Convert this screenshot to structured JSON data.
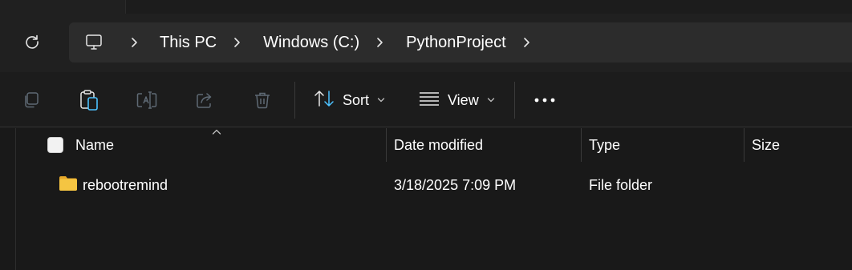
{
  "breadcrumb": [
    "This PC",
    "Windows (C:)",
    "PythonProject"
  ],
  "toolbar": {
    "sort_label": "Sort",
    "view_label": "View"
  },
  "columns": {
    "name": "Name",
    "date_modified": "Date modified",
    "type": "Type",
    "size": "Size"
  },
  "rows": [
    {
      "name": "rebootremind",
      "date_modified": "3/18/2025 7:09 PM",
      "type": "File folder",
      "size": ""
    }
  ],
  "icons": {
    "refresh": "refresh-icon",
    "this_pc": "monitor-icon",
    "copy": "copy-icon",
    "paste": "paste-icon",
    "rename": "rename-icon",
    "share": "share-icon",
    "delete": "trash-icon",
    "sort": "sort-icon",
    "view": "view-icon",
    "more": "more-icon",
    "folder": "folder-icon"
  },
  "colors": {
    "folder": "#f5c542",
    "accent": "#4cc2ff",
    "disabled_icon": "#5f6a75"
  }
}
